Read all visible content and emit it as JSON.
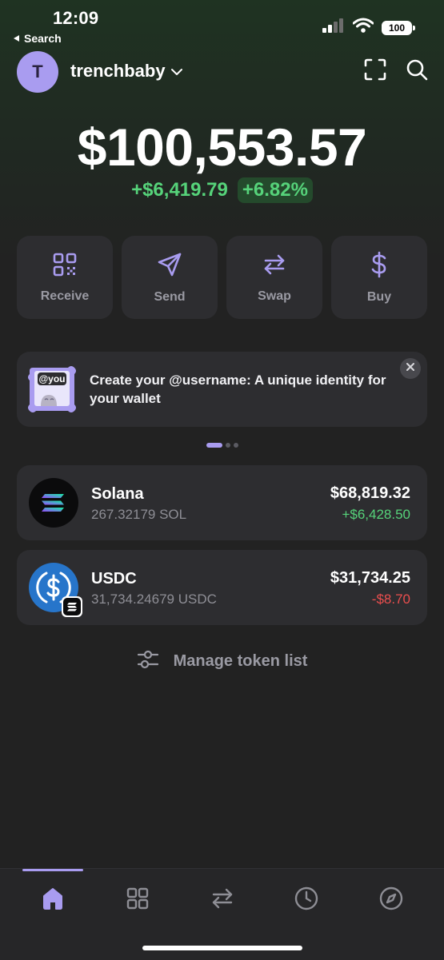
{
  "status_bar": {
    "time": "12:09",
    "back_label": "Search",
    "battery": "100"
  },
  "header": {
    "avatar_initial": "T",
    "account_name": "trenchbaby"
  },
  "balance": {
    "total": "$100,553.57",
    "change_usd": "+$6,419.79",
    "change_pct": "+6.82%"
  },
  "actions": [
    {
      "label": "Receive",
      "icon": "qr-code-icon"
    },
    {
      "label": "Send",
      "icon": "send-icon"
    },
    {
      "label": "Swap",
      "icon": "swap-icon"
    },
    {
      "label": "Buy",
      "icon": "dollar-icon"
    }
  ],
  "banner": {
    "art_tag": "@you",
    "text": "Create your @username: A unique identity for your wallet",
    "page": 1,
    "pages": 3
  },
  "tokens": [
    {
      "name": "Solana",
      "amount": "267.32179 SOL",
      "value": "$68,819.32",
      "change": "+$6,428.50",
      "trend": "up"
    },
    {
      "name": "USDC",
      "amount": "31,734.24679 USDC",
      "value": "$31,734.25",
      "change": "-$8.70",
      "trend": "down"
    }
  ],
  "manage": {
    "label": "Manage token list"
  },
  "tabs": [
    {
      "name": "home",
      "active": true
    },
    {
      "name": "collectibles",
      "active": false
    },
    {
      "name": "swap",
      "active": false
    },
    {
      "name": "activity",
      "active": false
    },
    {
      "name": "explore",
      "active": false
    }
  ],
  "colors": {
    "accent": "#a99cf0",
    "positive": "#56d37a",
    "negative": "#ea4e4e",
    "card": "#2d2d30"
  }
}
